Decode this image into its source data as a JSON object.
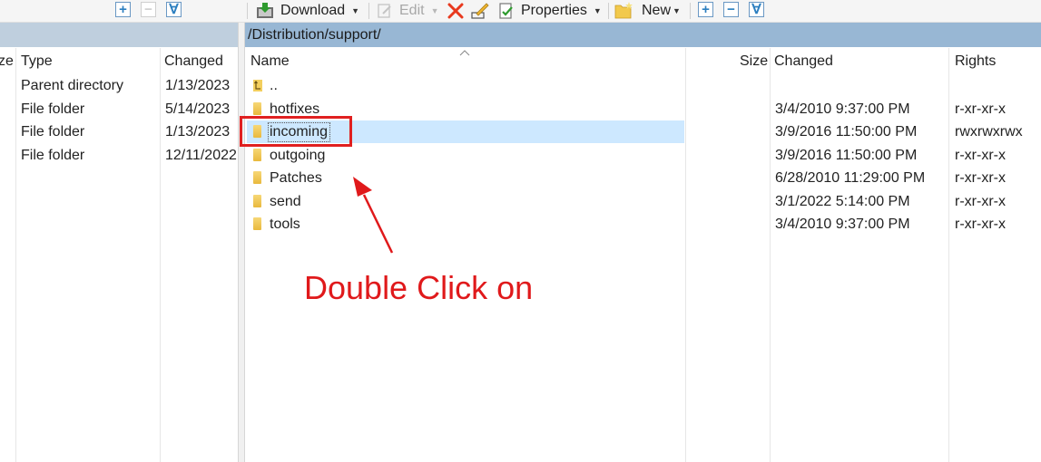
{
  "toolbar": {
    "download_label": "Download",
    "edit_label": "Edit",
    "properties_label": "Properties",
    "new_label": "New",
    "plus_glyph": "+",
    "minus_glyph": "−",
    "filter_glyph": "∀"
  },
  "left_pane": {
    "columns": {
      "size": "ze",
      "type": "Type",
      "changed": "Changed"
    },
    "rows": [
      {
        "type": "Parent directory",
        "changed": "1/13/2023"
      },
      {
        "type": "File folder",
        "changed": "5/14/2023"
      },
      {
        "type": "File folder",
        "changed": "1/13/2023"
      },
      {
        "type": "File folder",
        "changed": "12/11/2022"
      }
    ]
  },
  "right_pane": {
    "path": "/Distribution/support/",
    "columns": {
      "name": "Name",
      "size": "Size",
      "changed": "Changed",
      "rights": "Rights"
    },
    "rows": [
      {
        "name": "..",
        "changed": "",
        "rights": ""
      },
      {
        "name": "hotfixes",
        "changed": "3/4/2010 9:37:00 PM",
        "rights": "r-xr-xr-x"
      },
      {
        "name": "incoming",
        "changed": "3/9/2016 11:50:00 PM",
        "rights": "rwxrwxrwx",
        "selected": true
      },
      {
        "name": "outgoing",
        "changed": "3/9/2016 11:50:00 PM",
        "rights": "r-xr-xr-x"
      },
      {
        "name": "Patches",
        "changed": "6/28/2010 11:29:00 PM",
        "rights": "r-xr-xr-x"
      },
      {
        "name": "send",
        "changed": "3/1/2022 5:14:00 PM",
        "rights": "r-xr-xr-x"
      },
      {
        "name": "tools",
        "changed": "3/4/2010 9:37:00 PM",
        "rights": "r-xr-xr-x"
      }
    ]
  },
  "annotation": {
    "text": "Double Click on",
    "color": "#e0191b"
  },
  "colors": {
    "selection": "#cde8ff",
    "path_bar": "#98b7d4",
    "highlight_box": "#e02020"
  }
}
